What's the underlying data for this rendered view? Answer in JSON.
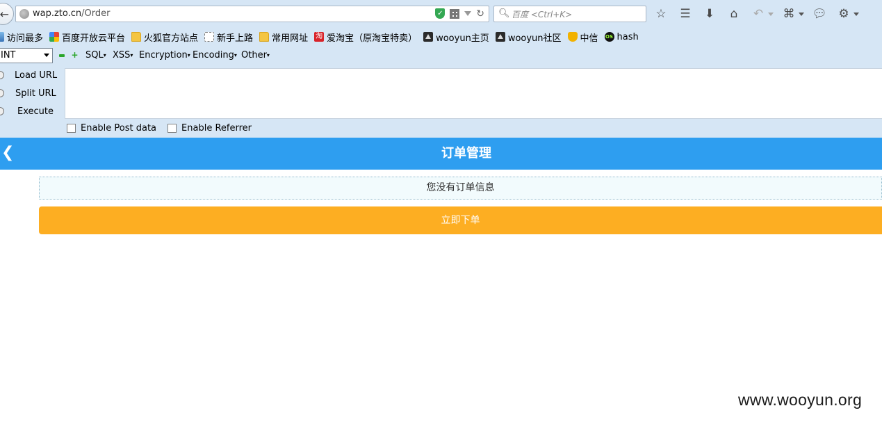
{
  "browser": {
    "url_host": "wap.zto.cn",
    "url_path": "/Order",
    "search_placeholder": "百度 <Ctrl+K>",
    "bookmarks": [
      {
        "label": "访问最多",
        "icon": "most-visited-icon"
      },
      {
        "label": "百度开放云平台",
        "icon": "baidu-cloud-icon"
      },
      {
        "label": "火狐官方站点",
        "icon": "folder-icon"
      },
      {
        "label": "新手上路",
        "icon": "dashed-page-icon"
      },
      {
        "label": "常用网址",
        "icon": "folder-icon"
      },
      {
        "label": "爱淘宝（原淘宝特卖）",
        "icon": "taobao-icon"
      },
      {
        "label": "wooyun主页",
        "icon": "wooyun-icon"
      },
      {
        "label": "wooyun社区",
        "icon": "wooyun-icon"
      },
      {
        "label": "中信",
        "icon": "trophy-icon"
      },
      {
        "label": "hash",
        "icon": "os-icon"
      }
    ]
  },
  "hackbar": {
    "select_value": "INT",
    "menus": [
      "SQL",
      "XSS",
      "Encryption",
      "Encoding",
      "Other"
    ],
    "actions": [
      "Load URL",
      "Split URL",
      "Execute"
    ],
    "options": [
      "Enable Post data",
      "Enable Referrer"
    ]
  },
  "page": {
    "title": "订单管理",
    "empty_message": "您没有订单信息",
    "order_button": "立即下单",
    "header_color": "#2e9ef0",
    "button_color": "#fdae22"
  },
  "watermark": "www.wooyun.org"
}
